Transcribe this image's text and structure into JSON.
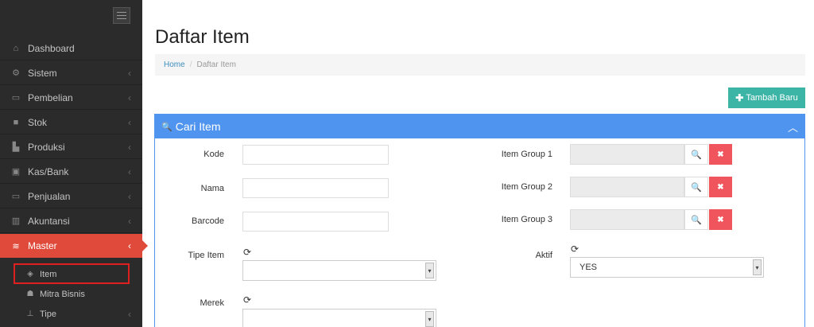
{
  "sidebar": {
    "items": [
      {
        "label": "Dashboard",
        "icon": "home-icon",
        "glyph": "⌂"
      },
      {
        "label": "Sistem",
        "icon": "gears-icon",
        "glyph": "⚙"
      },
      {
        "label": "Pembelian",
        "icon": "cart-icon",
        "glyph": "▭"
      },
      {
        "label": "Stok",
        "icon": "box-icon",
        "glyph": "■"
      },
      {
        "label": "Produksi",
        "icon": "industry-icon",
        "glyph": "▙"
      },
      {
        "label": "Kas/Bank",
        "icon": "money-icon",
        "glyph": "▣"
      },
      {
        "label": "Penjualan",
        "icon": "cart-icon",
        "glyph": "▭"
      },
      {
        "label": "Akuntansi",
        "icon": "bar-chart-icon",
        "glyph": "▥"
      },
      {
        "label": "Master",
        "icon": "database-icon",
        "glyph": "≋"
      }
    ],
    "sub_items": [
      {
        "label": "Item",
        "icon": "cube-icon",
        "glyph": "◈"
      },
      {
        "label": "Mitra Bisnis",
        "icon": "users-icon",
        "glyph": "☗"
      },
      {
        "label": "Tipe",
        "icon": "sitemap-icon",
        "glyph": "⊥"
      }
    ],
    "chevron": "‹"
  },
  "page": {
    "title": "Daftar Item",
    "breadcrumb": {
      "home": "Home",
      "separator": "/",
      "current": "Daftar Item"
    },
    "add_button": "Tambah Baru",
    "add_glyph": "✚"
  },
  "panel": {
    "title": "Cari Item",
    "search_glyph": "🔍",
    "collapse_glyph": "︿",
    "labels": {
      "kode": "Kode",
      "nama": "Nama",
      "barcode": "Barcode",
      "tipe_item": "Tipe Item",
      "merek": "Merek",
      "item_group_1": "Item Group 1",
      "item_group_2": "Item Group 2",
      "item_group_3": "Item Group 3",
      "aktif": "Aktif"
    },
    "values": {
      "kode": "",
      "nama": "",
      "barcode": "",
      "tipe_item": "",
      "merek": "",
      "aktif": "YES"
    },
    "refresh_glyph": "⟳",
    "clear_glyph": "✖",
    "search_btn_glyph": "🔍",
    "select_arrow": "▾"
  },
  "colors": {
    "sidebar_bg": "#2b2b2b",
    "active_item": "#e04a3b",
    "panel_header": "#4f94ee",
    "add_button": "#3cb4a6",
    "clear_button": "#f0545d",
    "breadcrumb_link": "#3c8dbc"
  }
}
